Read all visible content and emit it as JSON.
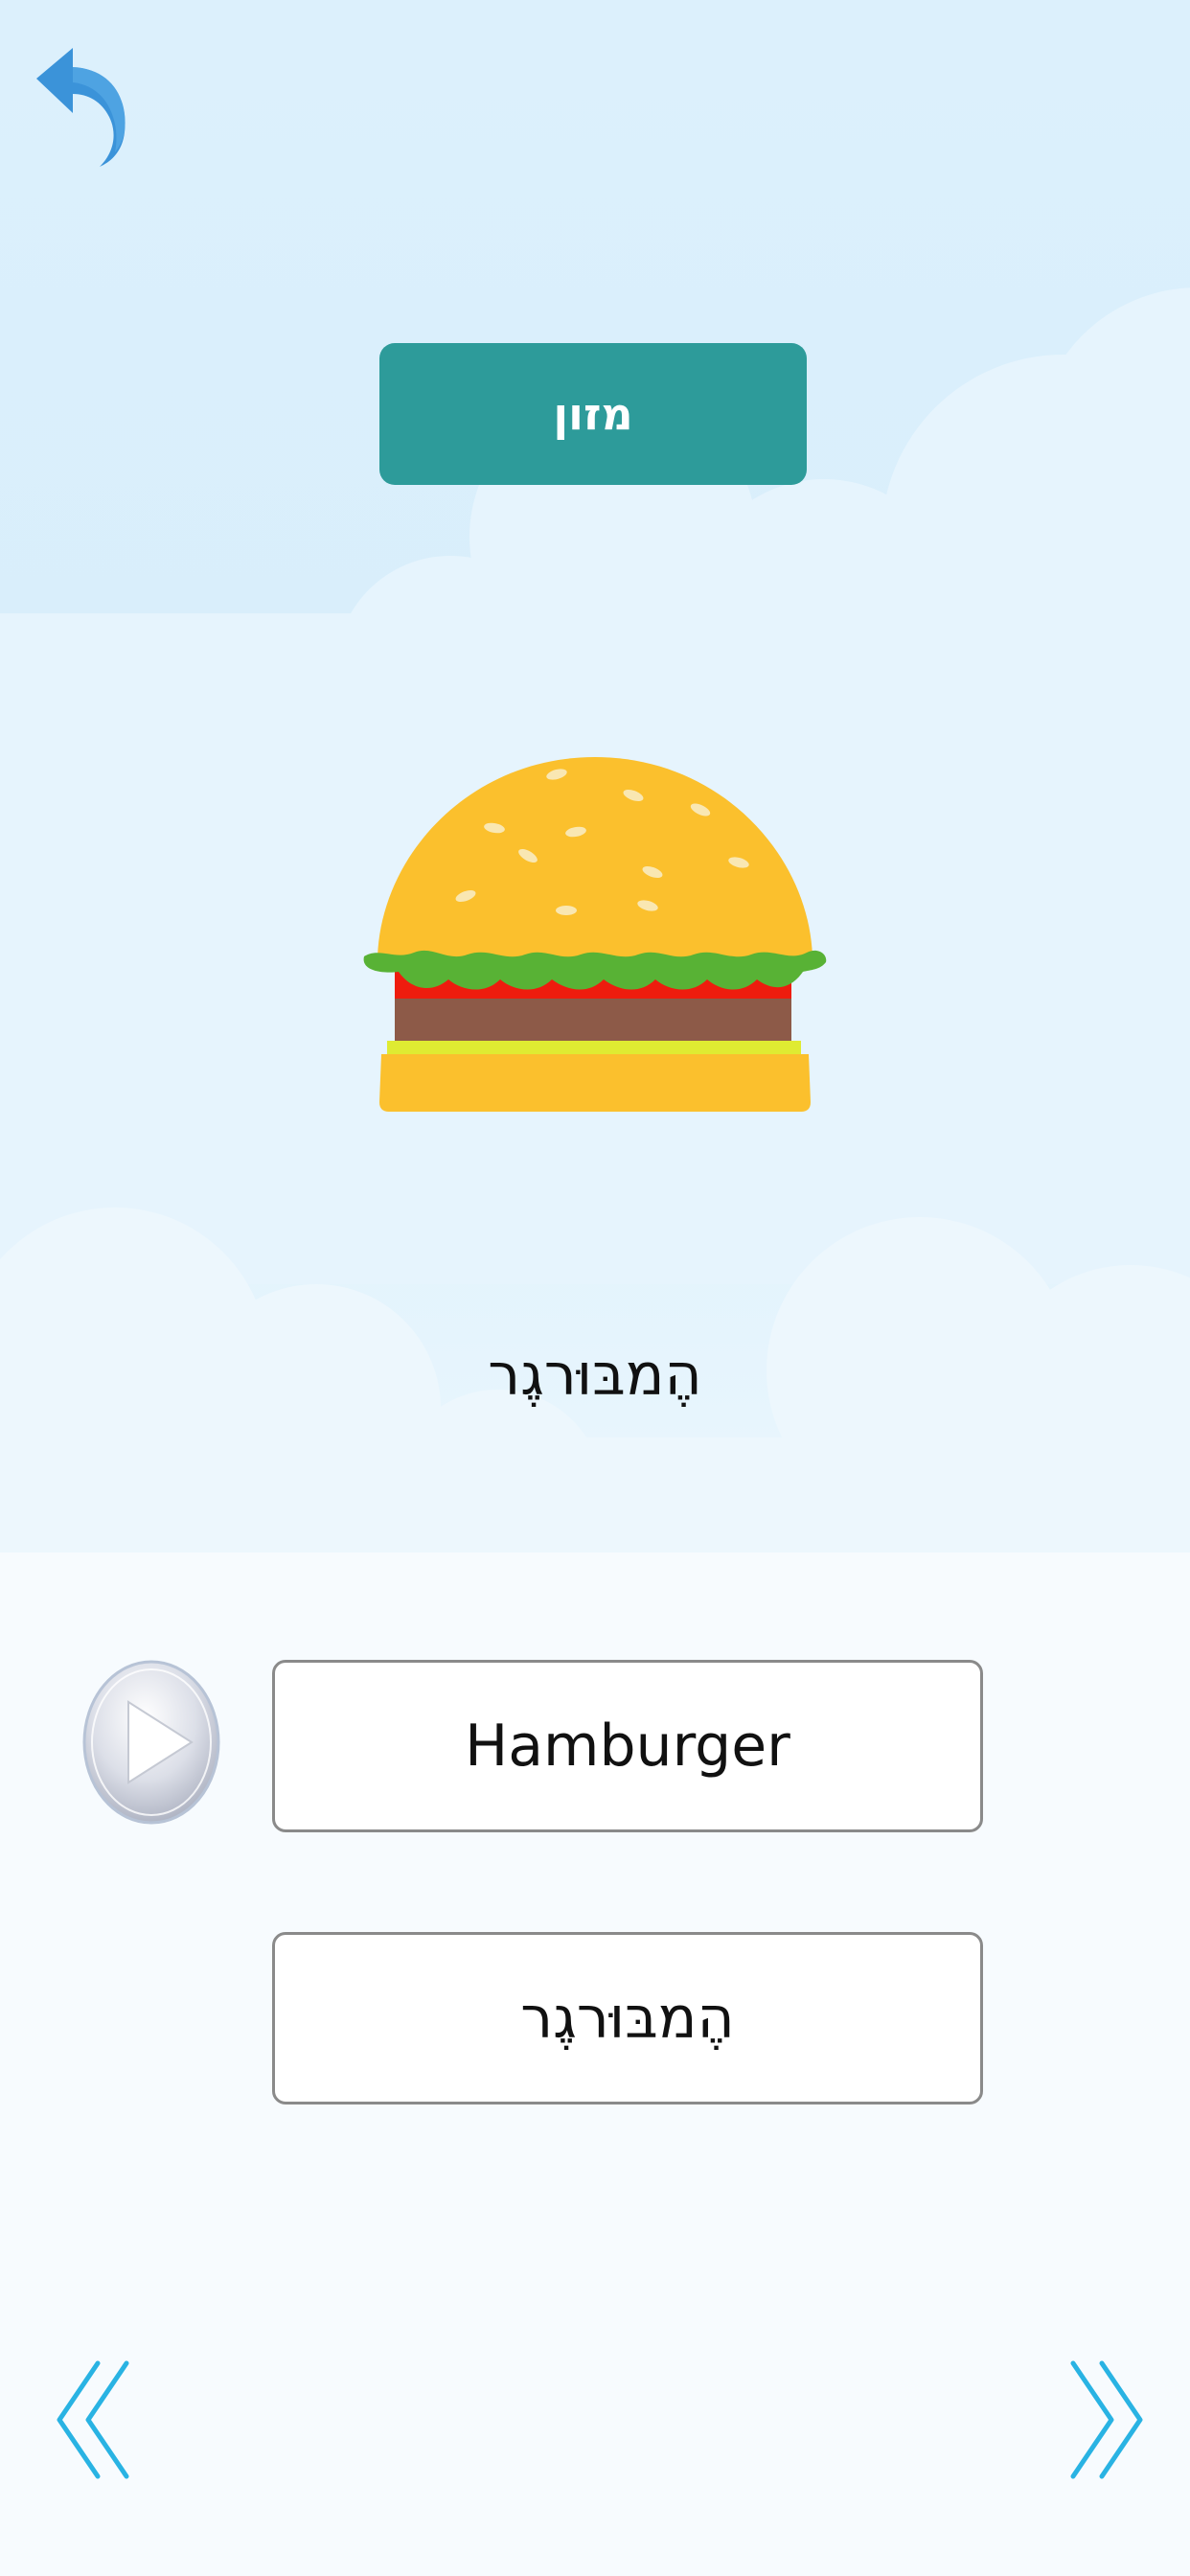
{
  "category": {
    "label": "מזון"
  },
  "word": {
    "heading": "הֶמבּוּרגֶר",
    "image_icon": "hamburger-icon"
  },
  "answers": {
    "english": "Hamburger",
    "hebrew": "הֶמבּוּרגֶר"
  },
  "controls": {
    "back_icon": "back-arrow-icon",
    "play_icon": "play-icon",
    "prev_icon": "double-chevron-left-icon",
    "next_icon": "double-chevron-right-icon"
  },
  "colors": {
    "category_badge": "#2d9b9a",
    "nav_arrows": "#29b3e3",
    "back_arrow": "#3b93d9",
    "bun": "#fbc02d",
    "lettuce": "#58b235",
    "tomato": "#ee1c0e",
    "patty": "#8d5a48",
    "cheese": "#dfeb32"
  }
}
